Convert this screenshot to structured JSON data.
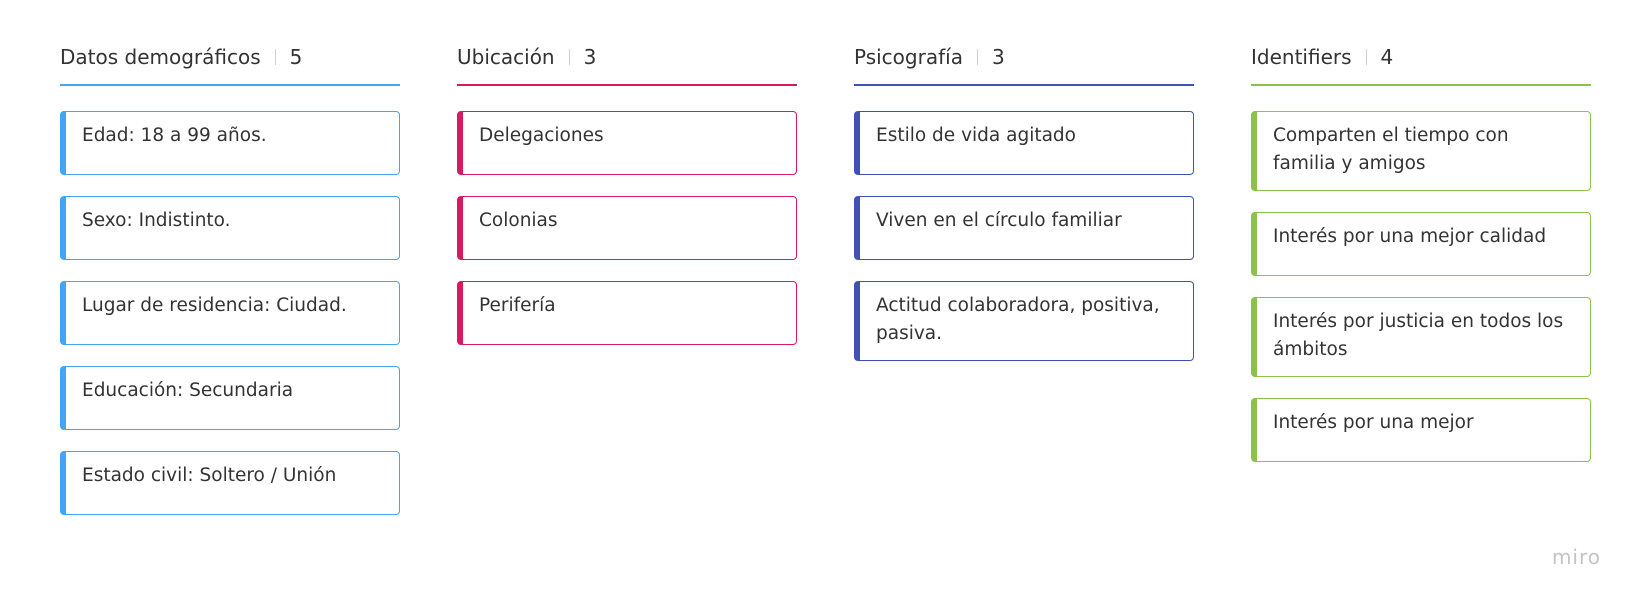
{
  "board": {
    "columns": [
      {
        "title": "Datos demográficos",
        "count": "5",
        "color": "#42a5f5",
        "cards": [
          "Edad: 18 a 99 años.",
          "Sexo: Indistinto.",
          "Lugar de residencia: Ciudad.",
          "Educación: Secundaria",
          "Estado civil: Soltero / Unión"
        ]
      },
      {
        "title": "Ubicación",
        "count": "3",
        "color": "#d81b60",
        "cards": [
          "Delegaciones",
          "Colonias",
          "Perifería"
        ]
      },
      {
        "title": "Psicografía",
        "count": "3",
        "color": "#3f51b5",
        "cards": [
          "Estilo de vida agitado",
          "Viven en el círculo familiar",
          "Actitud colaboradora, positiva, pasiva."
        ]
      },
      {
        "title": "Identifiers",
        "count": "4",
        "color": "#8bc34a",
        "cards": [
          "Comparten el tiempo con familia y amigos",
          "Interés por una mejor calidad",
          "Interés por justicia en todos los ámbitos",
          "Interés por una mejor"
        ]
      }
    ]
  },
  "watermark": "miro"
}
